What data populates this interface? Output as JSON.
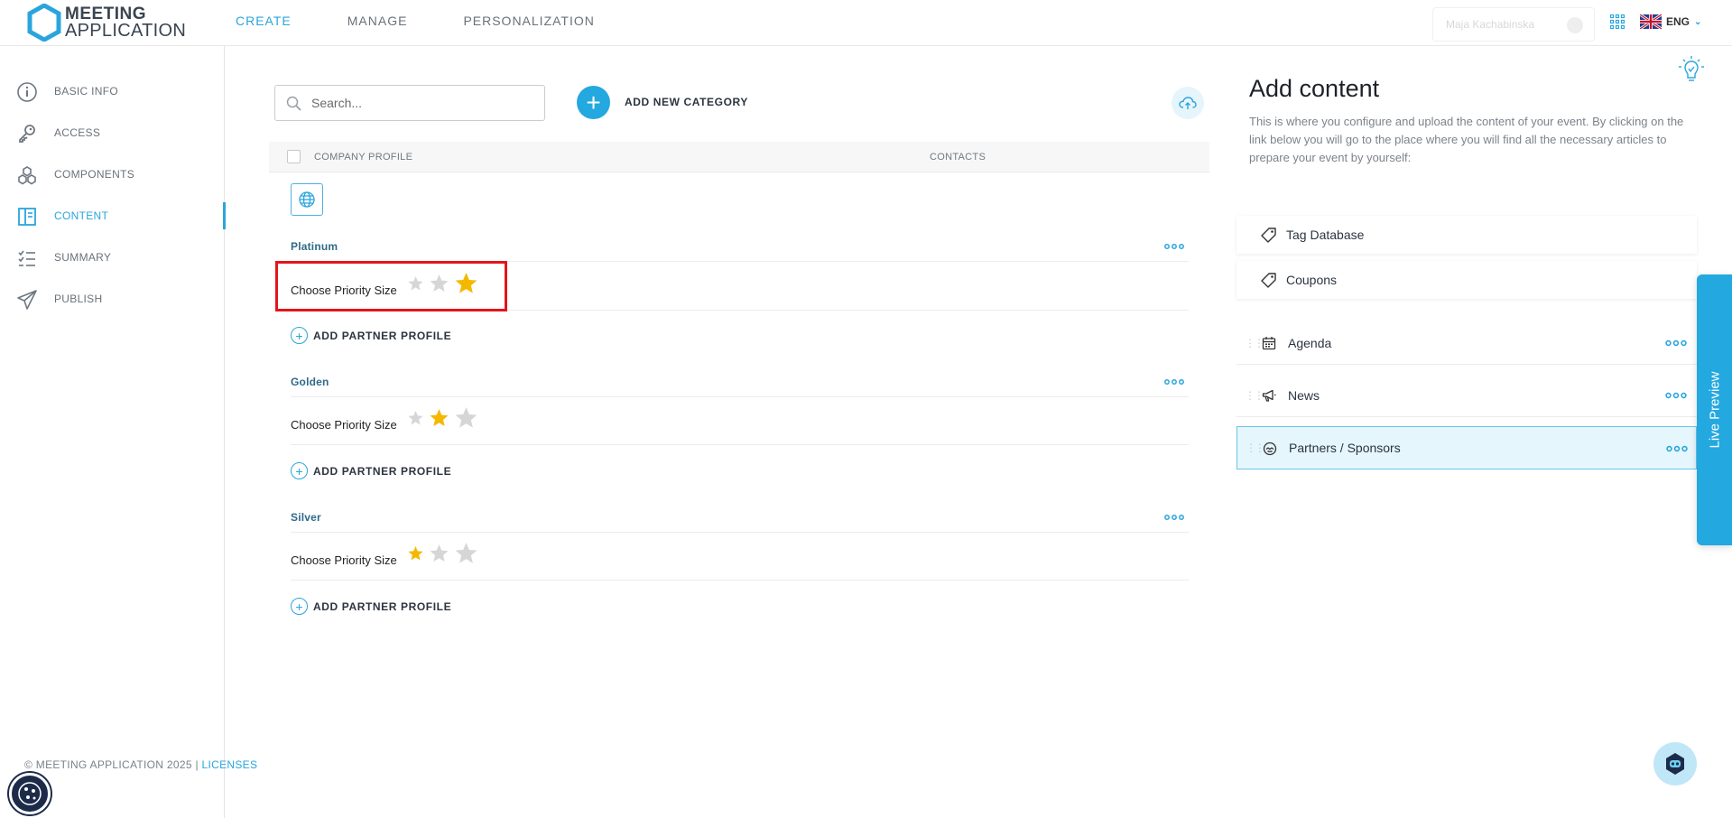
{
  "app": {
    "logo_line1": "MEETING",
    "logo_line2": "APPLICATION",
    "brand_color": "#2aa5dc"
  },
  "topnav": [
    {
      "label": "CREATE",
      "active": true
    },
    {
      "label": "MANAGE",
      "active": false
    },
    {
      "label": "PERSONALIZATION",
      "active": false
    }
  ],
  "header": {
    "user_name": "Maja Kachabinska",
    "language": "ENG"
  },
  "sidebar": {
    "items": [
      {
        "label": "BASIC INFO",
        "icon": "info-icon"
      },
      {
        "label": "ACCESS",
        "icon": "key-icon"
      },
      {
        "label": "COMPONENTS",
        "icon": "components-icon"
      },
      {
        "label": "CONTENT",
        "icon": "content-icon",
        "active": true
      },
      {
        "label": "SUMMARY",
        "icon": "checklist-icon"
      },
      {
        "label": "PUBLISH",
        "icon": "paper-plane-icon"
      }
    ]
  },
  "footer": {
    "copyright": "© MEETING APPLICATION 2025 | ",
    "licenses": "LICENSES"
  },
  "main": {
    "search_placeholder": "Search...",
    "add_category_label": "ADD NEW CATEGORY",
    "table_headers": {
      "company_profile": "COMPANY PROFILE",
      "contacts": "CONTACTS"
    },
    "categories": [
      {
        "name": "Platinum",
        "priority_label": "Choose Priority Size",
        "priority": 3,
        "add_label": "ADD PARTNER PROFILE"
      },
      {
        "name": "Golden",
        "priority_label": "Choose Priority Size",
        "priority": 2,
        "add_label": "ADD PARTNER PROFILE"
      },
      {
        "name": "Silver",
        "priority_label": "Choose Priority Size",
        "priority": 1,
        "add_label": "ADD PARTNER PROFILE"
      }
    ],
    "star_active_color": "#f5b800",
    "star_inactive_color": "#d6d6d6"
  },
  "right_panel": {
    "title": "Add content",
    "description": "This is where you configure and upload the content of your event. By clicking on the link below you will go to the place where you will find all the necessary articles to prepare your event by yourself:",
    "links": [
      {
        "label": "Tag Database",
        "icon": "tag-icon"
      },
      {
        "label": "Coupons",
        "icon": "tag-icon"
      }
    ],
    "modules": [
      {
        "label": "Agenda",
        "icon": "calendar-icon",
        "active": false
      },
      {
        "label": "News",
        "icon": "megaphone-icon",
        "active": false
      },
      {
        "label": "Partners / Sponsors",
        "icon": "handshake-icon",
        "active": true
      }
    ],
    "live_preview_label": "Live Preview"
  }
}
